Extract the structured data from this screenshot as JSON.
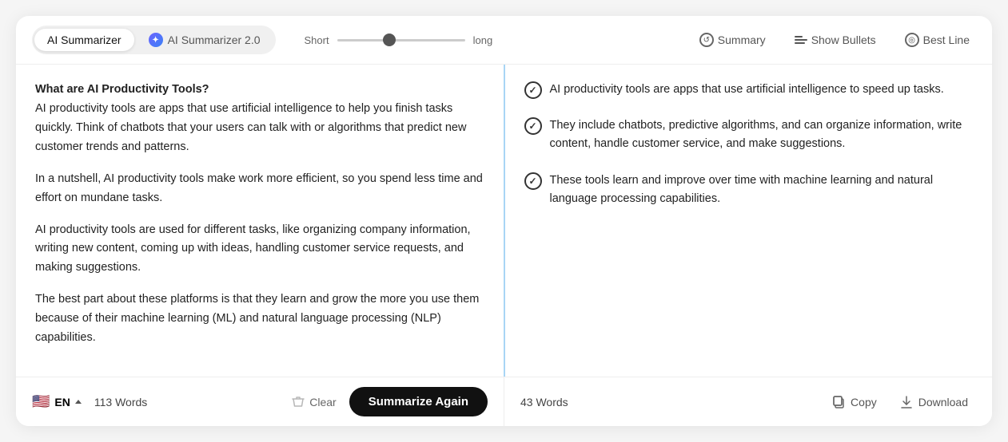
{
  "toolbar": {
    "tab1_label": "AI Summarizer",
    "tab2_label": "AI Summarizer 2.0",
    "slider_short": "Short",
    "slider_long": "long",
    "slider_value": 40,
    "action_summary": "Summary",
    "action_bullets": "Show Bullets",
    "action_bestline": "Best Line"
  },
  "left_panel": {
    "paragraphs": [
      "What are AI Productivity Tools?\nAI productivity tools are apps that use artificial intelligence to help you finish tasks quickly. Think of chatbots that your users can talk with or algorithms that predict new customer trends and patterns.",
      "In a nutshell, AI productivity tools make work more efficient, so you spend less time and effort on mundane tasks.",
      "AI productivity tools are used for different tasks, like organizing company information, writing new content, coming up with ideas, handling customer service requests, and making suggestions.",
      "The best part about these platforms is that they learn and grow the more you use them because of their machine learning (ML) and natural language processing (NLP) capabilities."
    ]
  },
  "right_panel": {
    "bullets": [
      "AI productivity tools are apps that use artificial intelligence to speed up tasks.",
      "They include chatbots, predictive algorithms, and can organize information, write content, handle customer service, and make suggestions.",
      "These tools learn and improve over time with machine learning and natural language processing capabilities."
    ]
  },
  "bottom_left": {
    "language": "EN",
    "word_count": "113 Words",
    "clear_label": "Clear",
    "summarize_label": "Summarize Again"
  },
  "bottom_right": {
    "word_count": "43 Words",
    "copy_label": "Copy",
    "download_label": "Download"
  }
}
